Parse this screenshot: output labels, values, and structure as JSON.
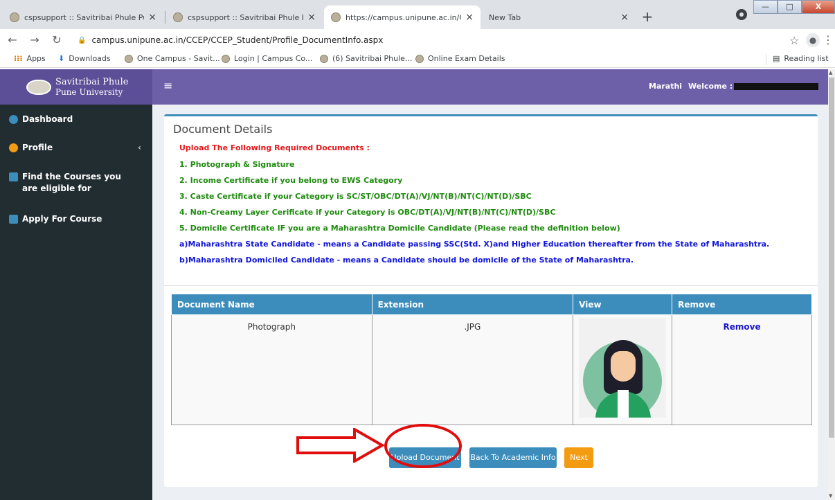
{
  "browser": {
    "tabs": [
      {
        "title": "cspsupport :: Savitribai Phule Pun",
        "close": "×"
      },
      {
        "title": "cspsupport :: Savitribai Phule Pun",
        "close": "×"
      },
      {
        "title": "https://campus.unipune.ac.in/CCE",
        "close": "×"
      },
      {
        "title": "New Tab",
        "close": "×"
      }
    ],
    "new_tab": "+",
    "window_buttons": {
      "minimize": "—",
      "maximize": "□",
      "close": "X"
    },
    "address": "campus.unipune.ac.in/CCEP/CCEP_Student/Profile_DocumentInfo.aspx",
    "bookmarks": [
      "Apps",
      "Downloads",
      "One Campus - Savit...",
      "Login | Campus Co...",
      "(6) Savitribai Phule...",
      "Online Exam Details"
    ],
    "reading_list": "Reading list"
  },
  "header": {
    "logo_line1": "Savitribai Phule",
    "logo_line2": "Pune University",
    "menu_icon": "≡",
    "language": "Marathi",
    "welcome": "Welcome :"
  },
  "sidebar": {
    "items": [
      {
        "label": "Dashboard",
        "icon": "dashboard-icon",
        "color": "#3c8dbc"
      },
      {
        "label": "Profile",
        "icon": "user-icon",
        "color": "#f39c12",
        "chevron": "‹"
      },
      {
        "label": "Find the Courses you are eligible for",
        "icon": "edit-icon",
        "color": "#3c8dbc"
      },
      {
        "label": "Apply For Course",
        "icon": "id-card-icon",
        "color": "#3c8dbc"
      }
    ]
  },
  "main": {
    "title": "Document Details",
    "requirements_heading": "Upload The Following Required Documents :",
    "requirements": [
      "1. Photograph & Signature",
      "2. Income Certificate if you belong to EWS Category",
      "3. Caste Certificate if your Category is SC/ST/OBC/DT(A)/VJ/NT(B)/NT(C)/NT(D)/SBC",
      "4. Non-Creamy Layer Cerificate if your Category is OBC/DT(A)/VJ/NT(B)/NT(C)/NT(D)/SBC",
      "5. Domicile Certificate IF you are a Maharashtra Domicile Candidate (Please read the definition below)"
    ],
    "definitions": [
      "a)Maharashtra State Candidate - means a Candidate passing SSC(Std. X)and Higher Education thereafter from the State of Maharashtra.",
      "b)Maharashtra Domiciled Candidate - means a Candidate should be domicile of the State of Maharashtra."
    ],
    "table": {
      "columns": [
        "Document Name",
        "Extension",
        "View",
        "Remove"
      ],
      "rows": [
        {
          "name": "Photograph",
          "extension": ".JPG",
          "view": "avatar-thumbnail",
          "remove": "Remove"
        }
      ]
    },
    "buttons": {
      "upload": "Upload Document",
      "back": "Back To Academic Info",
      "next": "Next"
    }
  },
  "colors": {
    "header": "#6e5fa9",
    "sidebar": "#222d32",
    "accent": "#3c8dbc",
    "next": "#f39c12",
    "annotation": "#e10c0c"
  }
}
